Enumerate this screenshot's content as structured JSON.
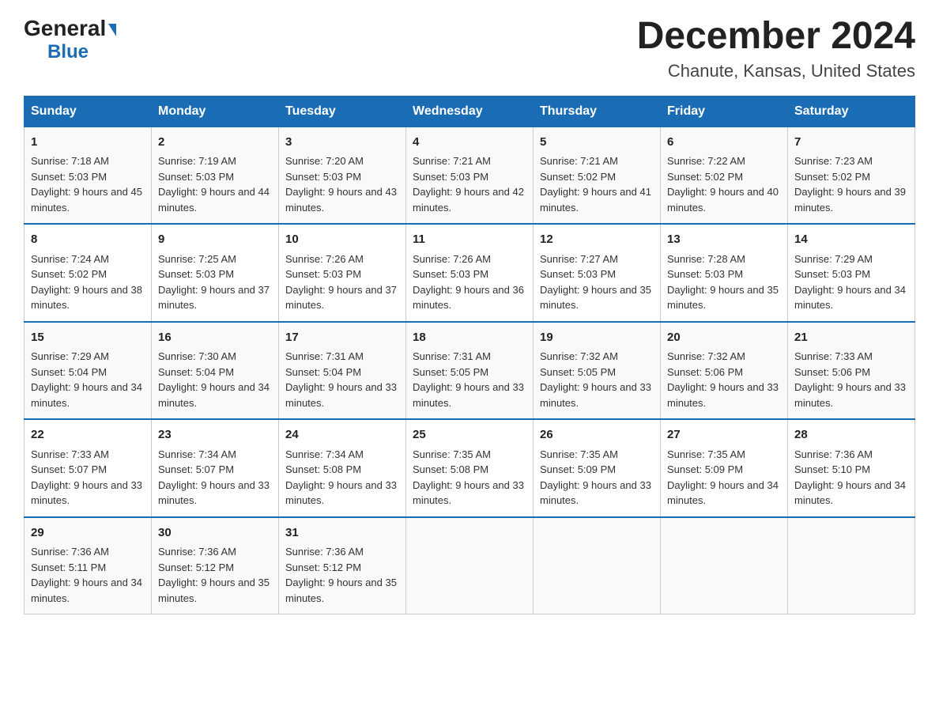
{
  "header": {
    "logo_general": "General",
    "logo_blue": "Blue",
    "title": "December 2024",
    "subtitle": "Chanute, Kansas, United States"
  },
  "days_of_week": [
    "Sunday",
    "Monday",
    "Tuesday",
    "Wednesday",
    "Thursday",
    "Friday",
    "Saturday"
  ],
  "weeks": [
    [
      {
        "num": "1",
        "sunrise": "7:18 AM",
        "sunset": "5:03 PM",
        "daylight": "9 hours and 45 minutes."
      },
      {
        "num": "2",
        "sunrise": "7:19 AM",
        "sunset": "5:03 PM",
        "daylight": "9 hours and 44 minutes."
      },
      {
        "num": "3",
        "sunrise": "7:20 AM",
        "sunset": "5:03 PM",
        "daylight": "9 hours and 43 minutes."
      },
      {
        "num": "4",
        "sunrise": "7:21 AM",
        "sunset": "5:03 PM",
        "daylight": "9 hours and 42 minutes."
      },
      {
        "num": "5",
        "sunrise": "7:21 AM",
        "sunset": "5:02 PM",
        "daylight": "9 hours and 41 minutes."
      },
      {
        "num": "6",
        "sunrise": "7:22 AM",
        "sunset": "5:02 PM",
        "daylight": "9 hours and 40 minutes."
      },
      {
        "num": "7",
        "sunrise": "7:23 AM",
        "sunset": "5:02 PM",
        "daylight": "9 hours and 39 minutes."
      }
    ],
    [
      {
        "num": "8",
        "sunrise": "7:24 AM",
        "sunset": "5:02 PM",
        "daylight": "9 hours and 38 minutes."
      },
      {
        "num": "9",
        "sunrise": "7:25 AM",
        "sunset": "5:03 PM",
        "daylight": "9 hours and 37 minutes."
      },
      {
        "num": "10",
        "sunrise": "7:26 AM",
        "sunset": "5:03 PM",
        "daylight": "9 hours and 37 minutes."
      },
      {
        "num": "11",
        "sunrise": "7:26 AM",
        "sunset": "5:03 PM",
        "daylight": "9 hours and 36 minutes."
      },
      {
        "num": "12",
        "sunrise": "7:27 AM",
        "sunset": "5:03 PM",
        "daylight": "9 hours and 35 minutes."
      },
      {
        "num": "13",
        "sunrise": "7:28 AM",
        "sunset": "5:03 PM",
        "daylight": "9 hours and 35 minutes."
      },
      {
        "num": "14",
        "sunrise": "7:29 AM",
        "sunset": "5:03 PM",
        "daylight": "9 hours and 34 minutes."
      }
    ],
    [
      {
        "num": "15",
        "sunrise": "7:29 AM",
        "sunset": "5:04 PM",
        "daylight": "9 hours and 34 minutes."
      },
      {
        "num": "16",
        "sunrise": "7:30 AM",
        "sunset": "5:04 PM",
        "daylight": "9 hours and 34 minutes."
      },
      {
        "num": "17",
        "sunrise": "7:31 AM",
        "sunset": "5:04 PM",
        "daylight": "9 hours and 33 minutes."
      },
      {
        "num": "18",
        "sunrise": "7:31 AM",
        "sunset": "5:05 PM",
        "daylight": "9 hours and 33 minutes."
      },
      {
        "num": "19",
        "sunrise": "7:32 AM",
        "sunset": "5:05 PM",
        "daylight": "9 hours and 33 minutes."
      },
      {
        "num": "20",
        "sunrise": "7:32 AM",
        "sunset": "5:06 PM",
        "daylight": "9 hours and 33 minutes."
      },
      {
        "num": "21",
        "sunrise": "7:33 AM",
        "sunset": "5:06 PM",
        "daylight": "9 hours and 33 minutes."
      }
    ],
    [
      {
        "num": "22",
        "sunrise": "7:33 AM",
        "sunset": "5:07 PM",
        "daylight": "9 hours and 33 minutes."
      },
      {
        "num": "23",
        "sunrise": "7:34 AM",
        "sunset": "5:07 PM",
        "daylight": "9 hours and 33 minutes."
      },
      {
        "num": "24",
        "sunrise": "7:34 AM",
        "sunset": "5:08 PM",
        "daylight": "9 hours and 33 minutes."
      },
      {
        "num": "25",
        "sunrise": "7:35 AM",
        "sunset": "5:08 PM",
        "daylight": "9 hours and 33 minutes."
      },
      {
        "num": "26",
        "sunrise": "7:35 AM",
        "sunset": "5:09 PM",
        "daylight": "9 hours and 33 minutes."
      },
      {
        "num": "27",
        "sunrise": "7:35 AM",
        "sunset": "5:09 PM",
        "daylight": "9 hours and 34 minutes."
      },
      {
        "num": "28",
        "sunrise": "7:36 AM",
        "sunset": "5:10 PM",
        "daylight": "9 hours and 34 minutes."
      }
    ],
    [
      {
        "num": "29",
        "sunrise": "7:36 AM",
        "sunset": "5:11 PM",
        "daylight": "9 hours and 34 minutes."
      },
      {
        "num": "30",
        "sunrise": "7:36 AM",
        "sunset": "5:12 PM",
        "daylight": "9 hours and 35 minutes."
      },
      {
        "num": "31",
        "sunrise": "7:36 AM",
        "sunset": "5:12 PM",
        "daylight": "9 hours and 35 minutes."
      },
      null,
      null,
      null,
      null
    ]
  ],
  "labels": {
    "sunrise": "Sunrise:",
    "sunset": "Sunset:",
    "daylight": "Daylight:"
  }
}
